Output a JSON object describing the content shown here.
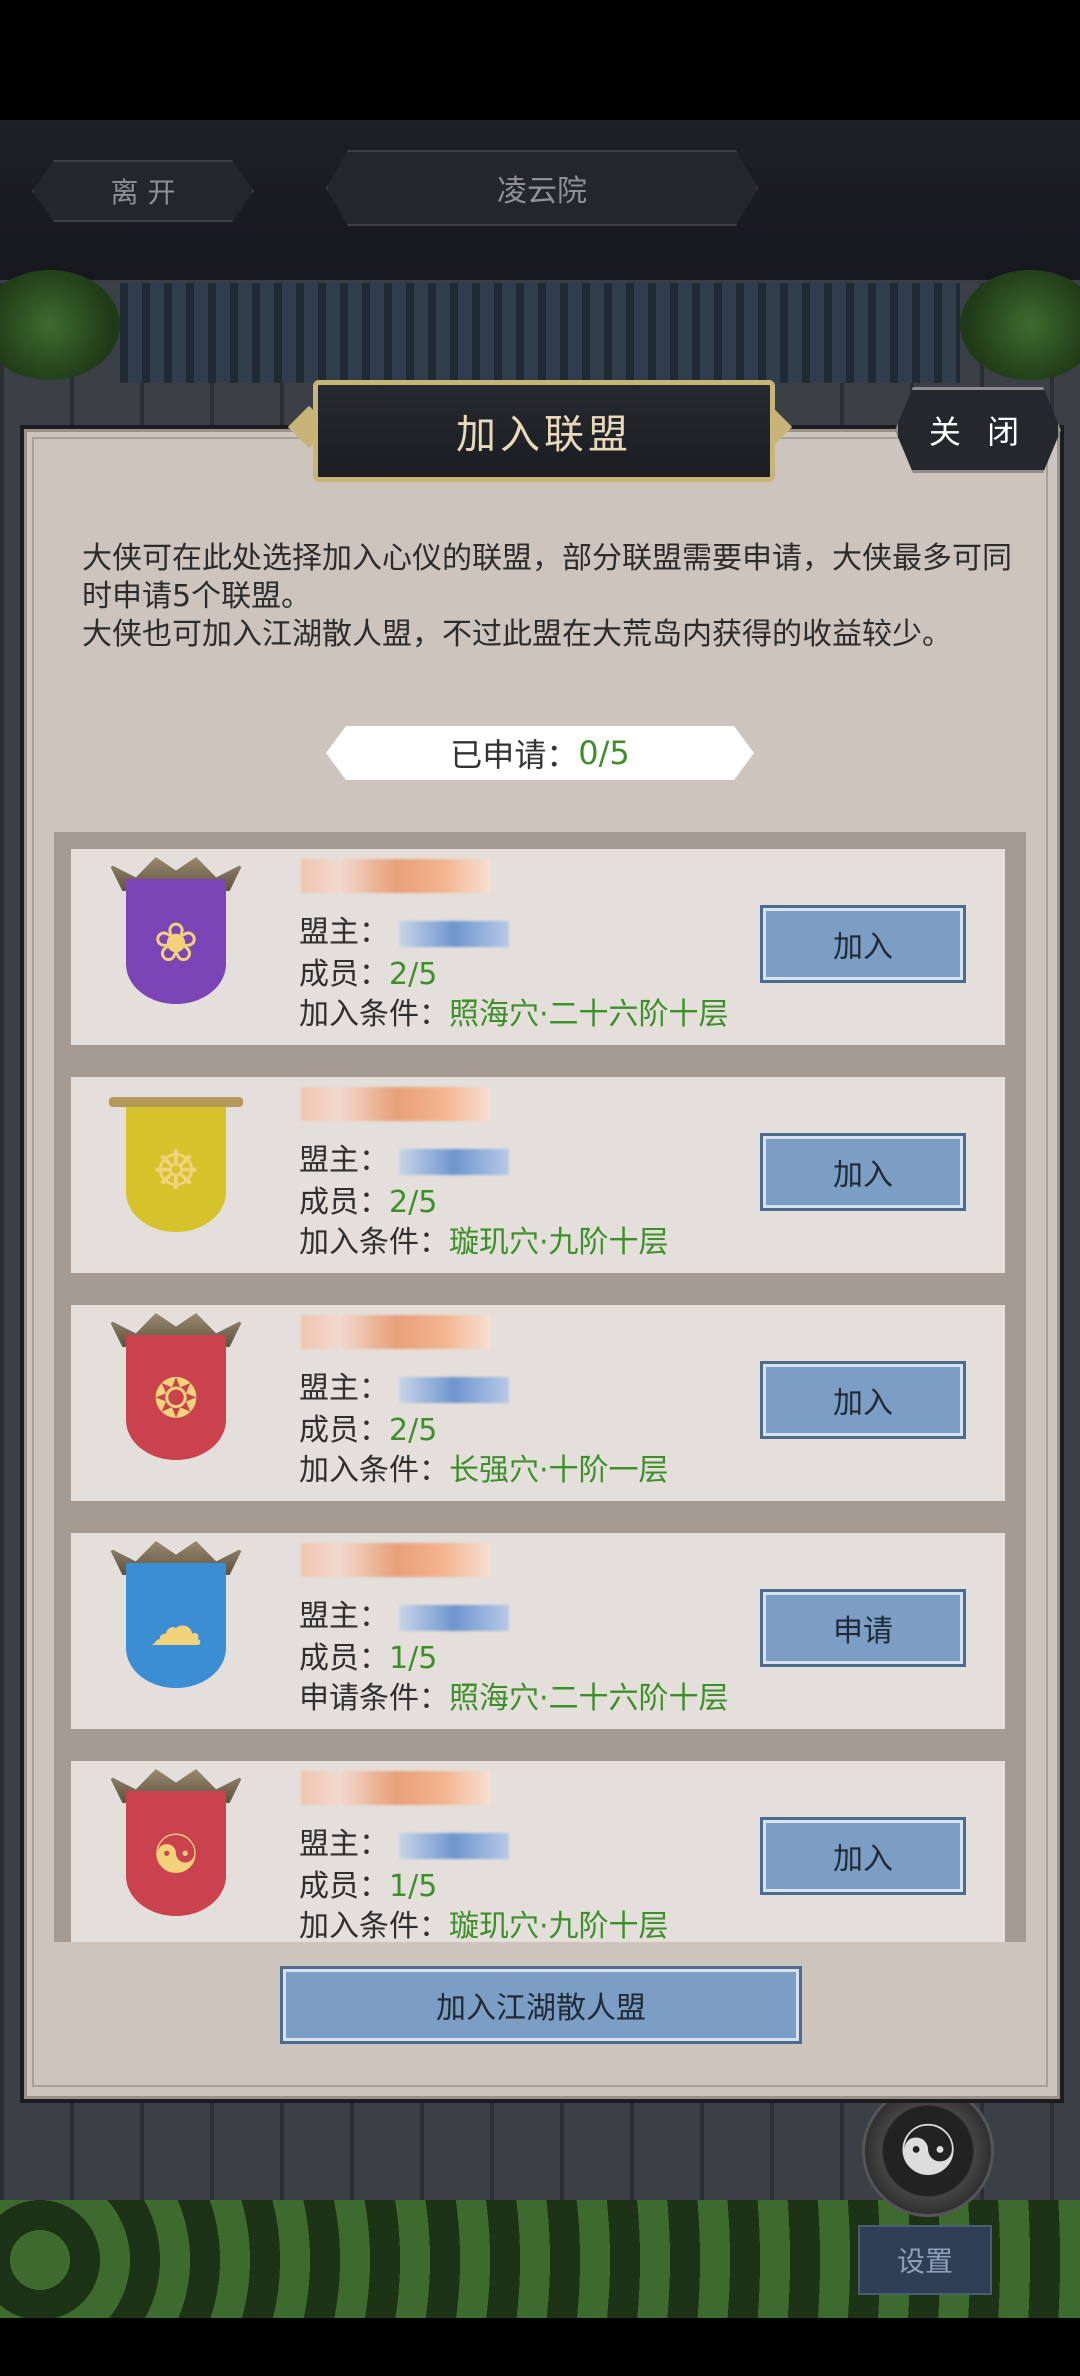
{
  "top_nav": {
    "leave_label": "离 开",
    "location_label": "凌云院"
  },
  "dialog": {
    "title": "加入联盟",
    "close_label": "关 闭",
    "description_lines": [
      "大侠可在此处选择加入心仪的联盟，部分联盟需要申请，大侠最多可同时申请5个联盟。",
      "大侠也可加入江湖散人盟，不过此盟在大荒岛内获得的收益较少。"
    ],
    "applied_label": "已申请：",
    "applied_value": "0/5",
    "alliances": [
      {
        "emblem_icon": "phoenix-icon",
        "banner_color": "#7b45b8",
        "glyph": "❀",
        "leader_label": "盟主：",
        "members_label": "成员：",
        "members": "2/5",
        "condition_label": "加入条件：",
        "condition": "照海穴·二十六阶十层",
        "action_label": "加入"
      },
      {
        "emblem_icon": "meditating-figure-icon",
        "banner_color": "#d6c22a",
        "glyph": "☸",
        "leader_label": "盟主：",
        "members_label": "成员：",
        "members": "2/5",
        "condition_label": "加入条件：",
        "condition": "璇玑穴·九阶十层",
        "action_label": "加入"
      },
      {
        "emblem_icon": "dragon-icon",
        "banner_color": "#c9424e",
        "glyph": "❂",
        "leader_label": "盟主：",
        "members_label": "成员：",
        "members": "2/5",
        "condition_label": "加入条件：",
        "condition": "长强穴·十阶一层",
        "action_label": "加入"
      },
      {
        "emblem_icon": "cloud-swirl-icon",
        "banner_color": "#3c8ed4",
        "glyph": "☁",
        "leader_label": "盟主：",
        "members_label": "成员：",
        "members": "1/5",
        "condition_label": "申请条件：",
        "condition": "照海穴·二十六阶十层",
        "action_label": "申请"
      },
      {
        "emblem_icon": "yin-yang-icon",
        "banner_color": "#c9424e",
        "glyph": "☯",
        "leader_label": "盟主：",
        "members_label": "成员：",
        "members": "1/5",
        "condition_label": "加入条件：",
        "condition": "璇玑穴·九阶十层",
        "action_label": "加入"
      }
    ],
    "wanderer_button_label": "加入江湖散人盟"
  },
  "bottom": {
    "settings_label": "设置",
    "taiji_icon": "yin-yang-icon"
  }
}
